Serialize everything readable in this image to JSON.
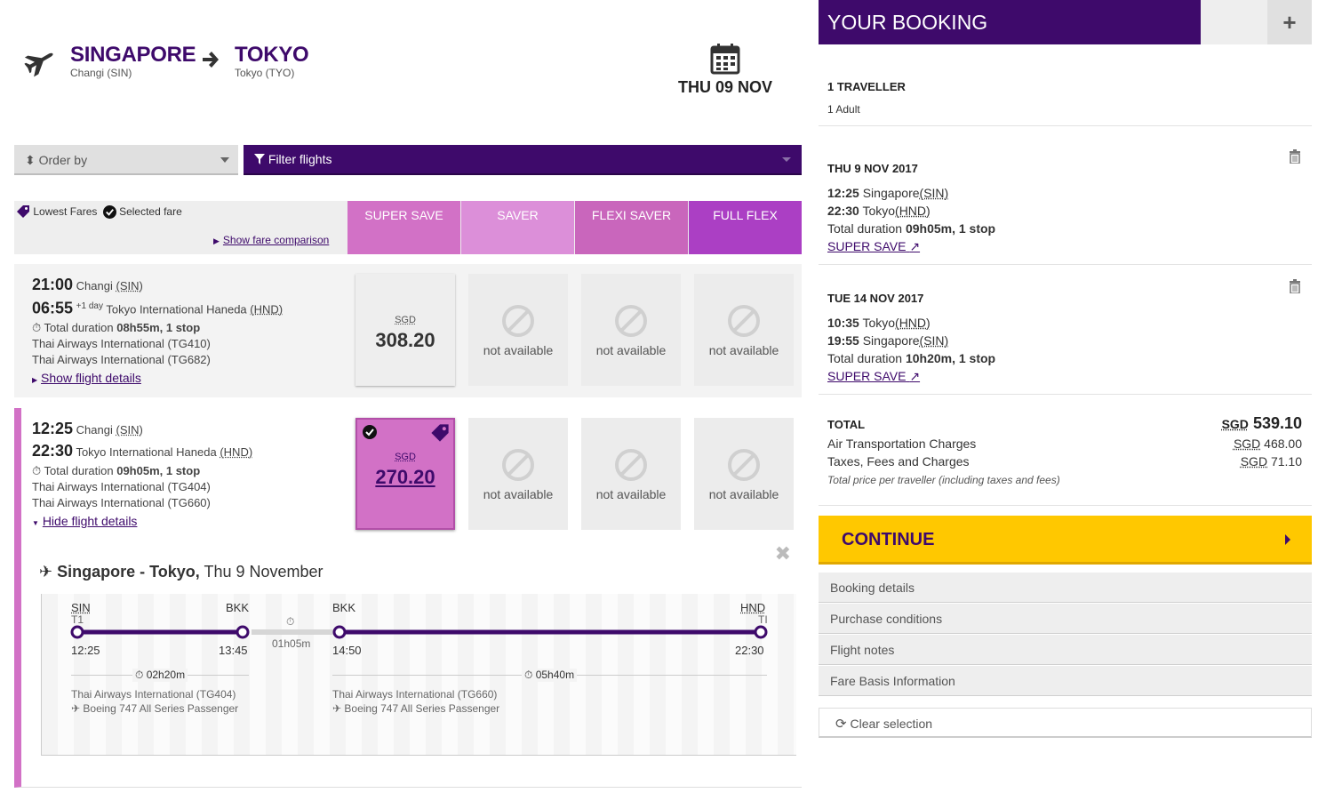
{
  "route": {
    "from_city": "SINGAPORE",
    "from_airport": "Changi (SIN)",
    "to_city": "TOKYO",
    "to_airport": "Tokyo (TYO)",
    "date": "THU 09 NOV"
  },
  "controls": {
    "order_by": "Order by",
    "filter": "Filter flights"
  },
  "fare_header": {
    "lowest_fares": "Lowest Fares",
    "selected_fare": "Selected fare",
    "comparison_link": "Show fare comparison",
    "columns": [
      {
        "label": "SUPER SAVE",
        "color": "#d271c6"
      },
      {
        "label": "SAVER",
        "color": "#dc8fd9"
      },
      {
        "label": "FLEXI SAVER",
        "color": "#c966bc"
      },
      {
        "label": "FULL FLEX",
        "color": "#ab3fc4"
      }
    ]
  },
  "flights": [
    {
      "dep_time": "21:00",
      "dep_airport": "Changi",
      "dep_code": "(SIN)",
      "arr_time": "06:55",
      "arr_day": "+1 day",
      "arr_airport": "Tokyo International Haneda",
      "arr_code": "(HND)",
      "duration_label": "Total duration",
      "duration": "08h55m, 1 stop",
      "airline1": "Thai Airways International (TG410)",
      "airline2": "Thai Airways International (TG682)",
      "details_link": "Show flight details",
      "currency": "SGD",
      "price": "308.20",
      "na": "not available"
    },
    {
      "dep_time": "12:25",
      "dep_airport": "Changi",
      "dep_code": "(SIN)",
      "arr_time": "22:30",
      "arr_airport": "Tokyo International Haneda",
      "arr_code": "(HND)",
      "duration_label": "Total duration",
      "duration": "09h05m, 1 stop",
      "airline1": "Thai Airways International (TG404)",
      "airline2": "Thai Airways International (TG660)",
      "details_link": "Hide flight details",
      "currency": "SGD",
      "price": "270.20",
      "na": "not available"
    }
  ],
  "details": {
    "title_bold": "Singapore - Tokyo,",
    "title_date": " Thu 9 November",
    "seg1": {
      "from": "SIN",
      "from_term": "T1",
      "to": "BKK",
      "dep": "12:25",
      "arr": "13:45",
      "duration": "02h20m",
      "airline": "Thai Airways International (TG404)",
      "aircraft": "Boeing 747 All Series Passenger"
    },
    "layover": "01h05m",
    "seg2": {
      "from": "BKK",
      "to": "HND",
      "to_term": "TI",
      "dep": "14:50",
      "arr": "22:30",
      "duration": "05h40m",
      "airline": "Thai Airways International (TG660)",
      "aircraft": "Boeing 747 All Series Passenger"
    }
  },
  "booking": {
    "title": "YOUR BOOKING",
    "plus": "+",
    "travellers": "1 TRAVELLER",
    "adults": "1 Adult",
    "outbound": {
      "date": "THU 9 NOV 2017",
      "dep_time": "12:25",
      "dep_city": "Singapore",
      "dep_code": "(SIN)",
      "arr_time": "22:30",
      "arr_city": "Tokyo",
      "arr_code": "(HND)",
      "duration_label": "Total duration",
      "duration": "09h05m, 1 stop",
      "fare": "SUPER SAVE"
    },
    "inbound": {
      "date": "TUE 14 NOV 2017",
      "dep_time": "10:35",
      "dep_city": "Tokyo",
      "dep_code": "(HND)",
      "arr_time": "19:55",
      "arr_city": "Singapore",
      "arr_code": "(SIN)",
      "duration_label": "Total duration",
      "duration": "10h20m, 1 stop",
      "fare": "SUPER SAVE"
    },
    "total_label": "TOTAL",
    "currency": "SGD",
    "total": "539.10",
    "air_label": "Air Transportation Charges",
    "air_value": "468.00",
    "tax_label": "Taxes, Fees and Charges",
    "tax_value": "71.10",
    "note": "Total price per traveller (including taxes and fees)",
    "continue": "CONTINUE",
    "accordion": [
      "Booking details",
      "Purchase conditions",
      "Flight notes",
      "Fare Basis Information"
    ],
    "clear": "Clear selection"
  },
  "colors": {
    "primary": "#3e0a6b",
    "accent": "#ffc800",
    "selected_fare": "#d271c6"
  }
}
